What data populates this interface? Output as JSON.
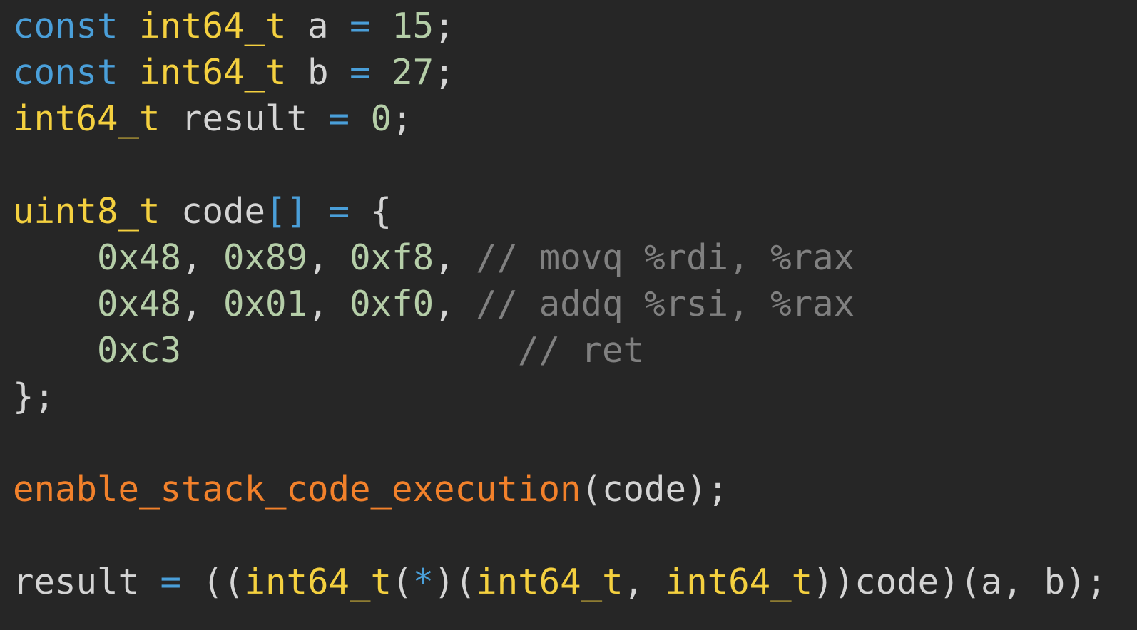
{
  "editor": {
    "background": "#262626",
    "colors": {
      "keyword": "#4a9fd9",
      "type": "#f4d03f",
      "identifier": "#d4d4d4",
      "operator": "#4a9fd9",
      "number": "#b5cea8",
      "comment": "#808080",
      "function": "#f2812b"
    },
    "lines": [
      [
        {
          "t": "const",
          "c": "kw"
        },
        {
          "t": " ",
          "c": "pl"
        },
        {
          "t": "int64_t",
          "c": "ty"
        },
        {
          "t": " a ",
          "c": "pl"
        },
        {
          "t": "=",
          "c": "op"
        },
        {
          "t": " ",
          "c": "pl"
        },
        {
          "t": "15",
          "c": "nu"
        },
        {
          "t": ";",
          "c": "pl"
        }
      ],
      [
        {
          "t": "const",
          "c": "kw"
        },
        {
          "t": " ",
          "c": "pl"
        },
        {
          "t": "int64_t",
          "c": "ty"
        },
        {
          "t": " b ",
          "c": "pl"
        },
        {
          "t": "=",
          "c": "op"
        },
        {
          "t": " ",
          "c": "pl"
        },
        {
          "t": "27",
          "c": "nu"
        },
        {
          "t": ";",
          "c": "pl"
        }
      ],
      [
        {
          "t": "int64_t",
          "c": "ty"
        },
        {
          "t": " result ",
          "c": "pl"
        },
        {
          "t": "=",
          "c": "op"
        },
        {
          "t": " ",
          "c": "pl"
        },
        {
          "t": "0",
          "c": "nu"
        },
        {
          "t": ";",
          "c": "pl"
        }
      ],
      [],
      [
        {
          "t": "uint8_t",
          "c": "ty"
        },
        {
          "t": " code",
          "c": "pl"
        },
        {
          "t": "[]",
          "c": "op"
        },
        {
          "t": " ",
          "c": "pl"
        },
        {
          "t": "=",
          "c": "op"
        },
        {
          "t": " {",
          "c": "pl"
        }
      ],
      [
        {
          "t": "    ",
          "c": "pl"
        },
        {
          "t": "0x48",
          "c": "nu"
        },
        {
          "t": ", ",
          "c": "pl"
        },
        {
          "t": "0x89",
          "c": "nu"
        },
        {
          "t": ", ",
          "c": "pl"
        },
        {
          "t": "0xf8",
          "c": "nu"
        },
        {
          "t": ", ",
          "c": "pl"
        },
        {
          "t": "// movq %rdi, %rax",
          "c": "co"
        }
      ],
      [
        {
          "t": "    ",
          "c": "pl"
        },
        {
          "t": "0x48",
          "c": "nu"
        },
        {
          "t": ", ",
          "c": "pl"
        },
        {
          "t": "0x01",
          "c": "nu"
        },
        {
          "t": ", ",
          "c": "pl"
        },
        {
          "t": "0xf0",
          "c": "nu"
        },
        {
          "t": ", ",
          "c": "pl"
        },
        {
          "t": "// addq %rsi, %rax",
          "c": "co"
        }
      ],
      [
        {
          "t": "    ",
          "c": "pl"
        },
        {
          "t": "0xc3",
          "c": "nu"
        },
        {
          "t": "                ",
          "c": "pl"
        },
        {
          "t": "// ret",
          "c": "co"
        }
      ],
      [
        {
          "t": "};",
          "c": "pl"
        }
      ],
      [],
      [
        {
          "t": "enable_stack_code_execution",
          "c": "fn"
        },
        {
          "t": "(code);",
          "c": "pl"
        }
      ],
      [],
      [
        {
          "t": "result ",
          "c": "pl"
        },
        {
          "t": "=",
          "c": "op"
        },
        {
          "t": " ((",
          "c": "pl"
        },
        {
          "t": "int64_t",
          "c": "ty"
        },
        {
          "t": "(",
          "c": "pl"
        },
        {
          "t": "*",
          "c": "op"
        },
        {
          "t": ")(",
          "c": "pl"
        },
        {
          "t": "int64_t",
          "c": "ty"
        },
        {
          "t": ", ",
          "c": "pl"
        },
        {
          "t": "int64_t",
          "c": "ty"
        },
        {
          "t": "))code)(a, b);",
          "c": "pl"
        }
      ]
    ]
  }
}
